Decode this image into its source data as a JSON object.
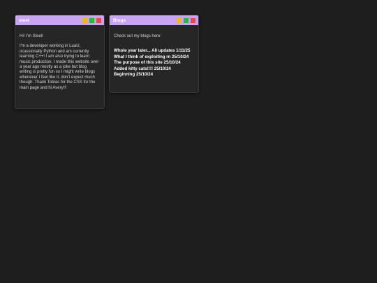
{
  "windows": {
    "steel": {
      "title": "steel",
      "paragraphs": [
        "Hi! I'm Steel!",
        "I'm a developer working in LuaU, ocassionally Python and am currently learning C++! I am also trying to learn music production. I made this website over a year ago mostly as a joke but blog writing is pretty fun so I might write blogs whenever I feel like it, don't expect much though. Thank Tobias for the CSS for the main page and hi Avery!!!"
      ]
    },
    "blogs": {
      "title": "Blogs",
      "intro": "Check out my blogs here:",
      "posts": [
        "Whole year later... All updates 1/11/25",
        "What I think of exploiting rn 25/10/24",
        "The purpose of this site 25/10/24",
        "Added kitty cats!!!! 25/10/24",
        "Beginning 25/10/24"
      ]
    }
  },
  "colors": {
    "background": "#1e1e1e",
    "window_bg": "#262626",
    "titlebar": "#c9a4f2",
    "minimize": "#f0b429",
    "maximize": "#2bb53a",
    "close": "#e5484d"
  }
}
